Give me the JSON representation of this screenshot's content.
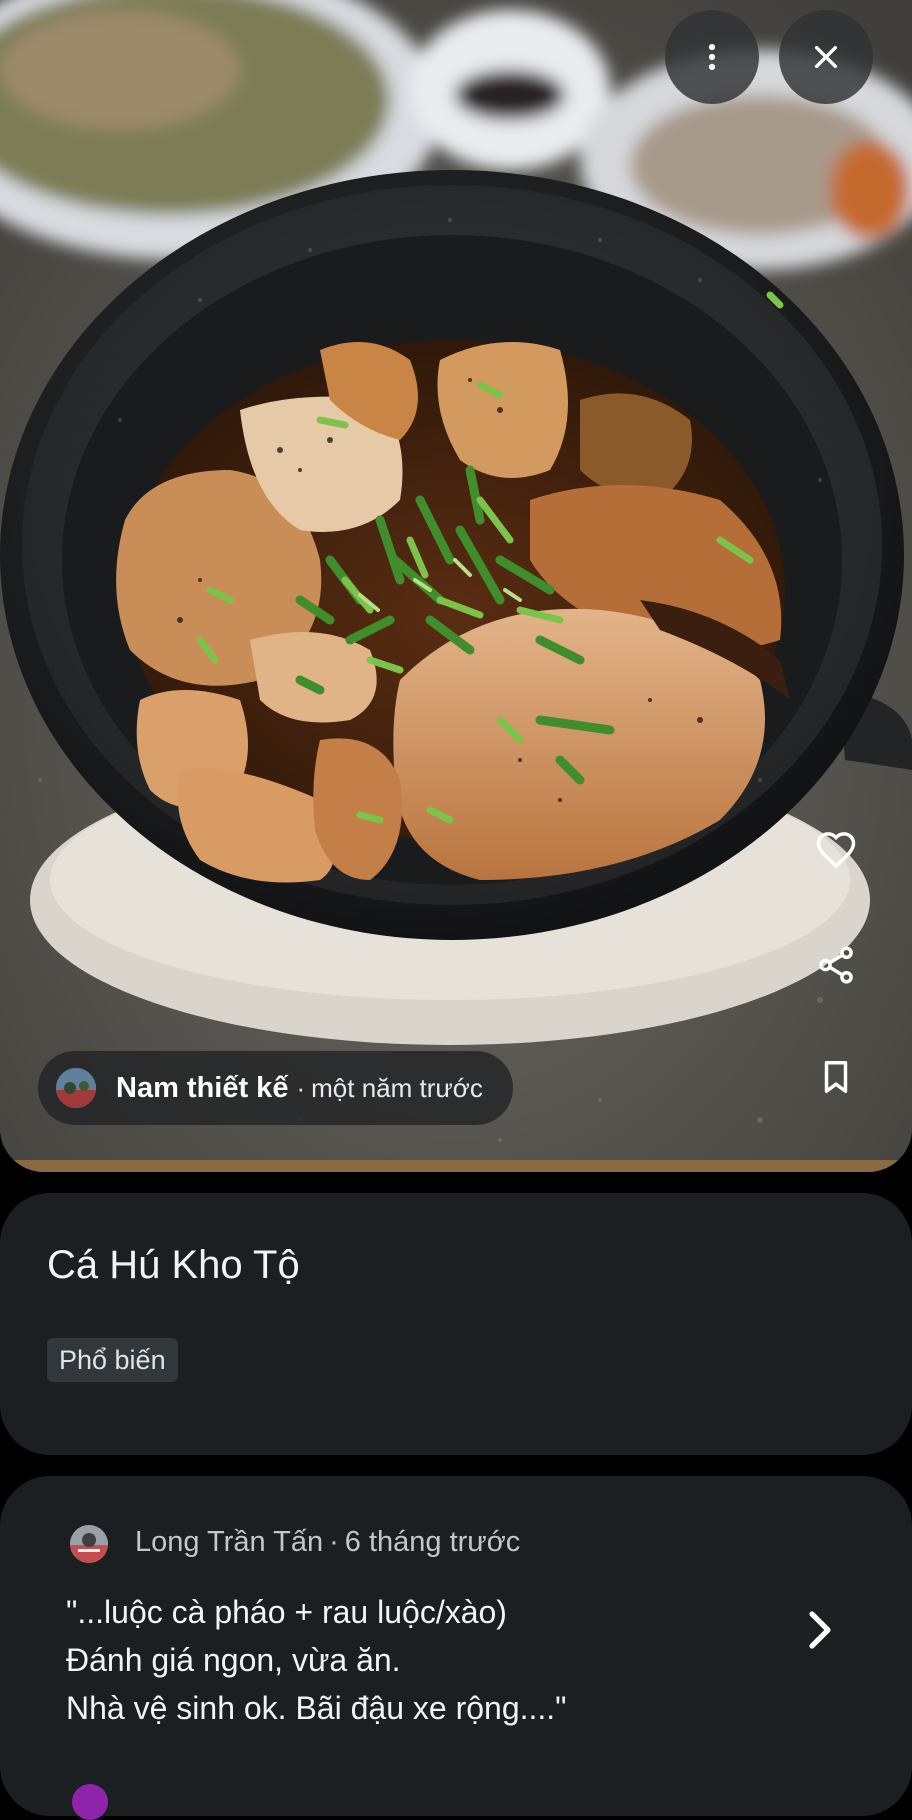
{
  "viewer": {
    "photo_subject": "Clay pot of braised catfish topped with chopped green onion",
    "icons": {
      "more": "more-vertical-icon",
      "close": "close-icon",
      "like": "heart-outline-icon",
      "share": "share-icon",
      "save": "bookmark-icon"
    },
    "author": {
      "name": "Nam thiết kế",
      "separator": "·",
      "time": "một năm trước"
    }
  },
  "dish": {
    "name": "Cá Hú Kho Tộ",
    "tag": "Phổ biến"
  },
  "review": {
    "reviewer_name": "Long Trần Tấn",
    "separator": "·",
    "time": "6 tháng trước",
    "lines": [
      "\"...luộc cà pháo + rau luộc/xào)",
      "Đánh giá ngon, vừa ăn.",
      "Nhà vệ sinh ok. Bãi đậu xe rộng....\""
    ],
    "chevron_icon": "chevron-right-icon"
  },
  "colors": {
    "background": "#000000",
    "card": "#1b1f21",
    "chip": "#31373a",
    "text_primary": "#f1f3f4",
    "text_secondary": "#c4c7c5"
  }
}
